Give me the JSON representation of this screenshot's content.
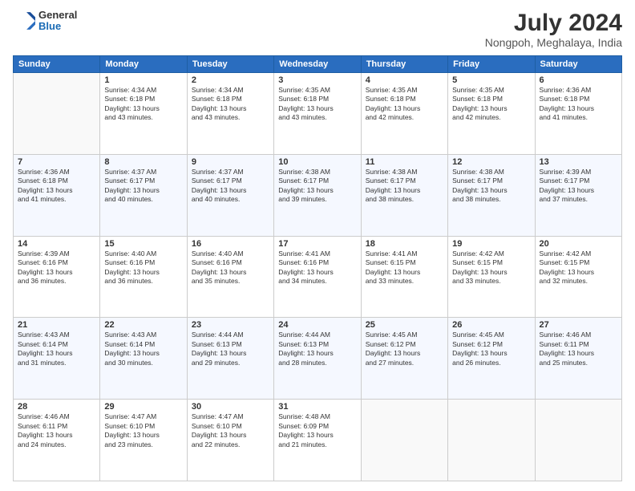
{
  "header": {
    "logo_line1": "General",
    "logo_line2": "Blue",
    "month": "July 2024",
    "location": "Nongpoh, Meghalaya, India"
  },
  "days_of_week": [
    "Sunday",
    "Monday",
    "Tuesday",
    "Wednesday",
    "Thursday",
    "Friday",
    "Saturday"
  ],
  "weeks": [
    [
      {
        "day": "",
        "info": ""
      },
      {
        "day": "1",
        "info": "Sunrise: 4:34 AM\nSunset: 6:18 PM\nDaylight: 13 hours\nand 43 minutes."
      },
      {
        "day": "2",
        "info": "Sunrise: 4:34 AM\nSunset: 6:18 PM\nDaylight: 13 hours\nand 43 minutes."
      },
      {
        "day": "3",
        "info": "Sunrise: 4:35 AM\nSunset: 6:18 PM\nDaylight: 13 hours\nand 43 minutes."
      },
      {
        "day": "4",
        "info": "Sunrise: 4:35 AM\nSunset: 6:18 PM\nDaylight: 13 hours\nand 42 minutes."
      },
      {
        "day": "5",
        "info": "Sunrise: 4:35 AM\nSunset: 6:18 PM\nDaylight: 13 hours\nand 42 minutes."
      },
      {
        "day": "6",
        "info": "Sunrise: 4:36 AM\nSunset: 6:18 PM\nDaylight: 13 hours\nand 41 minutes."
      }
    ],
    [
      {
        "day": "7",
        "info": "Sunrise: 4:36 AM\nSunset: 6:18 PM\nDaylight: 13 hours\nand 41 minutes."
      },
      {
        "day": "8",
        "info": "Sunrise: 4:37 AM\nSunset: 6:17 PM\nDaylight: 13 hours\nand 40 minutes."
      },
      {
        "day": "9",
        "info": "Sunrise: 4:37 AM\nSunset: 6:17 PM\nDaylight: 13 hours\nand 40 minutes."
      },
      {
        "day": "10",
        "info": "Sunrise: 4:38 AM\nSunset: 6:17 PM\nDaylight: 13 hours\nand 39 minutes."
      },
      {
        "day": "11",
        "info": "Sunrise: 4:38 AM\nSunset: 6:17 PM\nDaylight: 13 hours\nand 38 minutes."
      },
      {
        "day": "12",
        "info": "Sunrise: 4:38 AM\nSunset: 6:17 PM\nDaylight: 13 hours\nand 38 minutes."
      },
      {
        "day": "13",
        "info": "Sunrise: 4:39 AM\nSunset: 6:17 PM\nDaylight: 13 hours\nand 37 minutes."
      }
    ],
    [
      {
        "day": "14",
        "info": "Sunrise: 4:39 AM\nSunset: 6:16 PM\nDaylight: 13 hours\nand 36 minutes."
      },
      {
        "day": "15",
        "info": "Sunrise: 4:40 AM\nSunset: 6:16 PM\nDaylight: 13 hours\nand 36 minutes."
      },
      {
        "day": "16",
        "info": "Sunrise: 4:40 AM\nSunset: 6:16 PM\nDaylight: 13 hours\nand 35 minutes."
      },
      {
        "day": "17",
        "info": "Sunrise: 4:41 AM\nSunset: 6:16 PM\nDaylight: 13 hours\nand 34 minutes."
      },
      {
        "day": "18",
        "info": "Sunrise: 4:41 AM\nSunset: 6:15 PM\nDaylight: 13 hours\nand 33 minutes."
      },
      {
        "day": "19",
        "info": "Sunrise: 4:42 AM\nSunset: 6:15 PM\nDaylight: 13 hours\nand 33 minutes."
      },
      {
        "day": "20",
        "info": "Sunrise: 4:42 AM\nSunset: 6:15 PM\nDaylight: 13 hours\nand 32 minutes."
      }
    ],
    [
      {
        "day": "21",
        "info": "Sunrise: 4:43 AM\nSunset: 6:14 PM\nDaylight: 13 hours\nand 31 minutes."
      },
      {
        "day": "22",
        "info": "Sunrise: 4:43 AM\nSunset: 6:14 PM\nDaylight: 13 hours\nand 30 minutes."
      },
      {
        "day": "23",
        "info": "Sunrise: 4:44 AM\nSunset: 6:13 PM\nDaylight: 13 hours\nand 29 minutes."
      },
      {
        "day": "24",
        "info": "Sunrise: 4:44 AM\nSunset: 6:13 PM\nDaylight: 13 hours\nand 28 minutes."
      },
      {
        "day": "25",
        "info": "Sunrise: 4:45 AM\nSunset: 6:12 PM\nDaylight: 13 hours\nand 27 minutes."
      },
      {
        "day": "26",
        "info": "Sunrise: 4:45 AM\nSunset: 6:12 PM\nDaylight: 13 hours\nand 26 minutes."
      },
      {
        "day": "27",
        "info": "Sunrise: 4:46 AM\nSunset: 6:11 PM\nDaylight: 13 hours\nand 25 minutes."
      }
    ],
    [
      {
        "day": "28",
        "info": "Sunrise: 4:46 AM\nSunset: 6:11 PM\nDaylight: 13 hours\nand 24 minutes."
      },
      {
        "day": "29",
        "info": "Sunrise: 4:47 AM\nSunset: 6:10 PM\nDaylight: 13 hours\nand 23 minutes."
      },
      {
        "day": "30",
        "info": "Sunrise: 4:47 AM\nSunset: 6:10 PM\nDaylight: 13 hours\nand 22 minutes."
      },
      {
        "day": "31",
        "info": "Sunrise: 4:48 AM\nSunset: 6:09 PM\nDaylight: 13 hours\nand 21 minutes."
      },
      {
        "day": "",
        "info": ""
      },
      {
        "day": "",
        "info": ""
      },
      {
        "day": "",
        "info": ""
      }
    ]
  ]
}
